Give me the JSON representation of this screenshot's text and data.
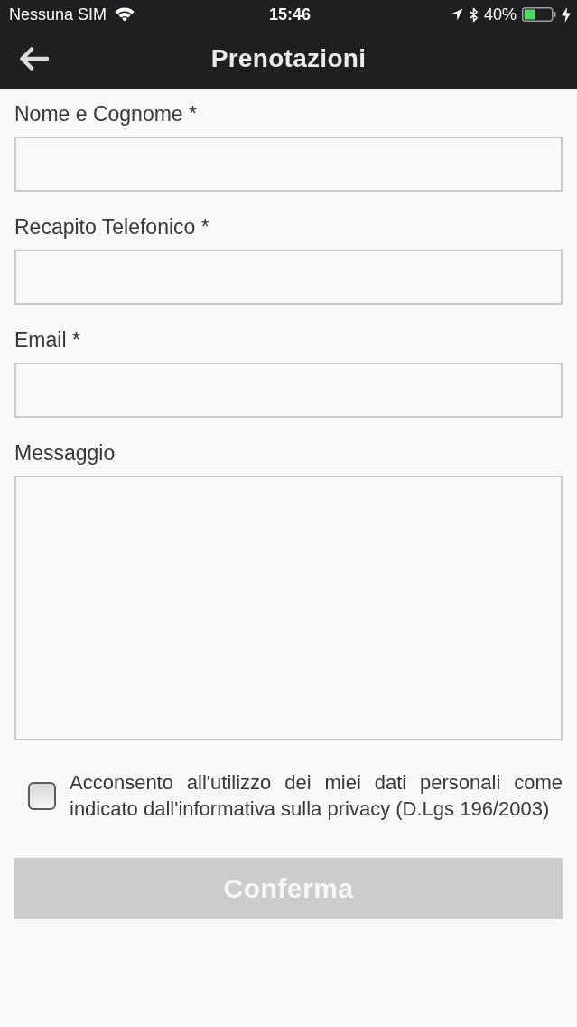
{
  "status_bar": {
    "carrier": "Nessuna SIM",
    "time": "15:46",
    "battery": "40%"
  },
  "header": {
    "title": "Prenotazioni"
  },
  "form": {
    "fields": [
      {
        "kind": "input",
        "label": "Nome e Cognome *"
      },
      {
        "kind": "input",
        "label": "Recapito Telefonico *"
      },
      {
        "kind": "input",
        "label": "Email *"
      },
      {
        "kind": "textarea",
        "label": "Messaggio"
      }
    ]
  },
  "consent": {
    "checked": false,
    "text": "Acconsento all'utilizzo dei miei dati personali come indicato dall'informativa sulla privacy (D.Lgs 196/2003)"
  },
  "submit": {
    "label": "Conferma",
    "disabled": true
  }
}
